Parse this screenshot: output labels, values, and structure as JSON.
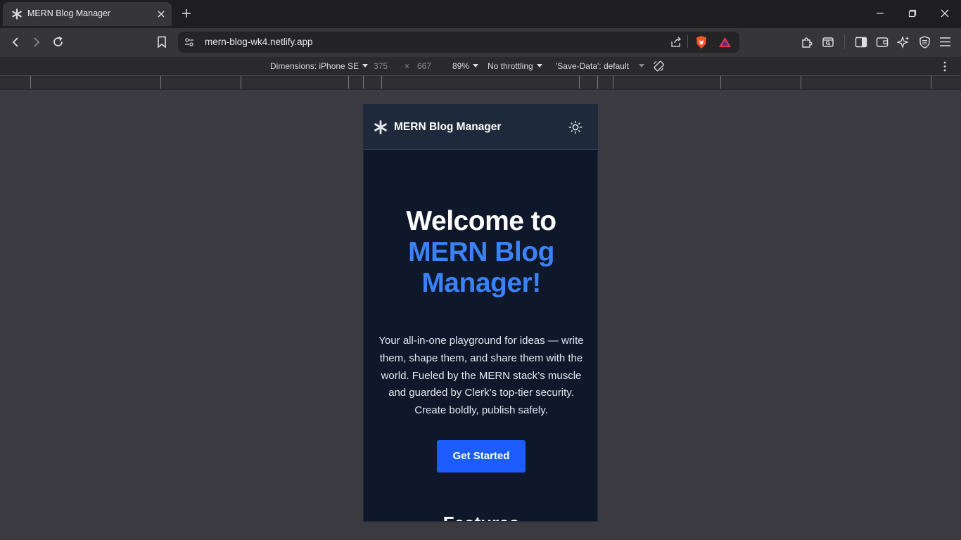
{
  "tab": {
    "title": "MERN Blog Manager"
  },
  "toolbar": {
    "url": "mern-blog-wk4.netlify.app"
  },
  "emulation": {
    "dimensions_label": "Dimensions: iPhone SE",
    "width": "375",
    "times": "×",
    "height": "667",
    "zoom": "89%",
    "throttling": "No throttling",
    "save_data": "'Save-Data': default"
  },
  "app": {
    "name": "MERN Blog Manager",
    "hero": {
      "line1": "Welcome to",
      "line2": "MERN Blog",
      "line3": "Manager!"
    },
    "description": "Your all-in-one playground for ideas — write them, shape them, and share them with the world. Fueled by the MERN stack’s muscle and guarded by Clerk’s top-tier security. Create boldly, publish safely.",
    "cta": "Get Started",
    "features_heading": "Features"
  },
  "colors": {
    "accent_blue": "#3b82f6",
    "button_blue": "#1d5cff",
    "app_bg": "#0f172a",
    "header_bg": "#1e293b"
  },
  "icons": [
    "snowflake-icon",
    "close-icon",
    "plus-icon",
    "minimize-icon",
    "restore-icon",
    "back-icon",
    "forward-icon",
    "reload-icon",
    "bookmark-icon",
    "site-settings-icon",
    "share-icon",
    "brave-shield-icon",
    "brave-rewards-icon",
    "extensions-icon",
    "search-tab-icon",
    "sidebar-icon",
    "wallet-icon",
    "leo-ai-icon",
    "vpn-icon",
    "menu-icon",
    "rotate-icon",
    "kebab-icon",
    "sun-icon"
  ]
}
